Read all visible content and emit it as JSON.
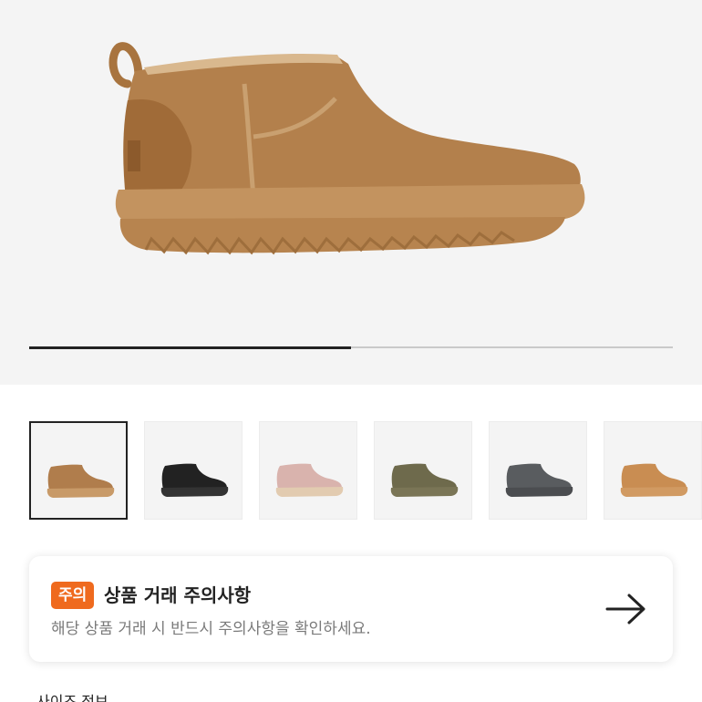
{
  "gallery": {
    "main_image": "suede-ankle-boot-chestnut",
    "progress_fraction": 0.5,
    "thumbnails": [
      {
        "name": "thumb-chestnut",
        "color": "#b07d4c",
        "sole": "#c89a68",
        "selected": true
      },
      {
        "name": "thumb-black",
        "color": "#222222",
        "sole": "#333333",
        "selected": false
      },
      {
        "name": "thumb-pink",
        "color": "#d9b3ad",
        "sole": "#e2cbb0",
        "selected": false
      },
      {
        "name": "thumb-olive",
        "color": "#6e6a4c",
        "sole": "#7a7556",
        "selected": false
      },
      {
        "name": "thumb-grey",
        "color": "#595c5f",
        "sole": "#4b4d50",
        "selected": false
      },
      {
        "name": "thumb-tan",
        "color": "#c98d52",
        "sole": "#d19a62",
        "selected": false
      }
    ]
  },
  "notice": {
    "badge": "주의",
    "title": "상품 거래 주의사항",
    "description": "해당 상품 거래 시 반드시 주의사항을 확인하세요.",
    "arrow_icon": "arrow-right-icon",
    "badge_color": "#ef6a1e"
  },
  "next_section": {
    "partial_text": "사이즈 정보"
  }
}
